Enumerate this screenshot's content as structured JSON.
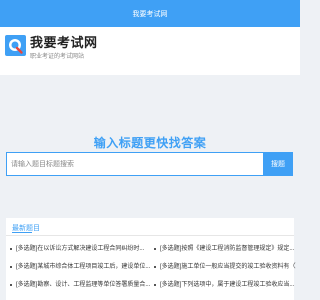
{
  "topbar": {
    "title": "我要考试网"
  },
  "header": {
    "site_name": "我要考试网",
    "slogan": "职业考证的考试网站"
  },
  "search": {
    "title": "输入标题更快找答案",
    "placeholder": "请输入题目标题搜索",
    "button_label": "搜题"
  },
  "latest": {
    "title": "最新题目",
    "left_items": [
      "[多选题]在以诉讼方式解决建设工程合同纠纷时...",
      "[多选题]某城市综合体工程项目竣工后，建设单位...",
      "[多选题]勘察、设计、工程监理等单位答署质量合..."
    ],
    "right_items": [
      "[多选题]按照《建设工程消防监督管理规定》规定...",
      "[多选题]施工单位一般应当提交的竣工验收资料有（）",
      "[多选题]下列选项中，属于建设工程竣工验收应当..."
    ]
  },
  "colors": {
    "accent": "#3fa0f5",
    "logo_red": "#e8453c"
  }
}
